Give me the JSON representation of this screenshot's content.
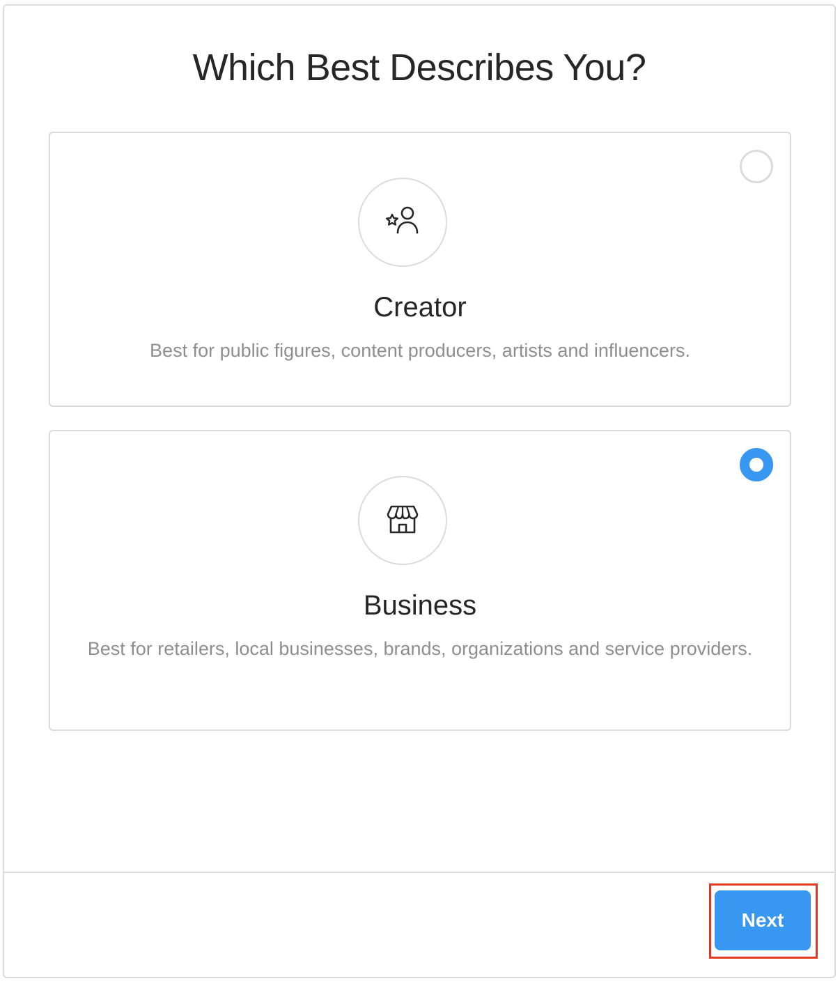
{
  "dialog": {
    "title": "Which Best Describes You?"
  },
  "options": [
    {
      "title": "Creator",
      "description": "Best for public figures, content producers, artists and influencers.",
      "icon": "creator-star-person-icon",
      "selected": false
    },
    {
      "title": "Business",
      "description": "Best for retailers, local businesses, brands, organizations and service providers.",
      "icon": "storefront-icon",
      "selected": true
    }
  ],
  "footer": {
    "next_label": "Next"
  },
  "colors": {
    "accent": "#3897f0",
    "highlight": "#e0391f",
    "border": "#dbdbdb",
    "text_primary": "#262626",
    "text_secondary": "#8e8e8e"
  }
}
